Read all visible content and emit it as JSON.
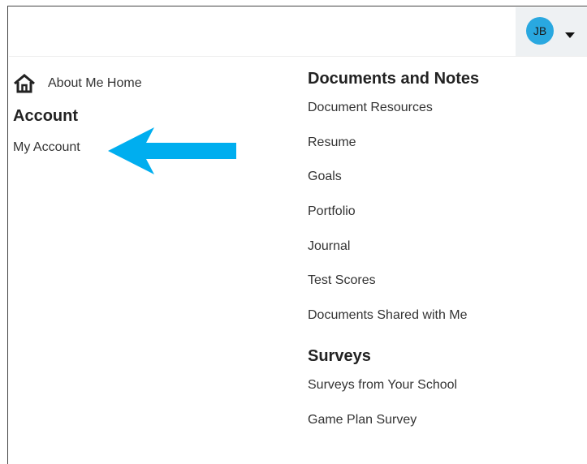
{
  "header": {
    "avatar_initials": "JB",
    "avatar_color": "#29a8e0"
  },
  "sidebar": {
    "home_label": "About Me Home",
    "account_heading": "Account",
    "my_account_label": "My Account",
    "arrow_color": "#00aeef"
  },
  "documents": {
    "heading": "Documents and Notes",
    "items": [
      "Document Resources",
      "Resume",
      "Goals",
      "Portfolio",
      "Journal",
      "Test Scores",
      "Documents Shared with Me"
    ]
  },
  "surveys": {
    "heading": "Surveys",
    "items": [
      "Surveys from Your School",
      "Game Plan Survey"
    ]
  }
}
